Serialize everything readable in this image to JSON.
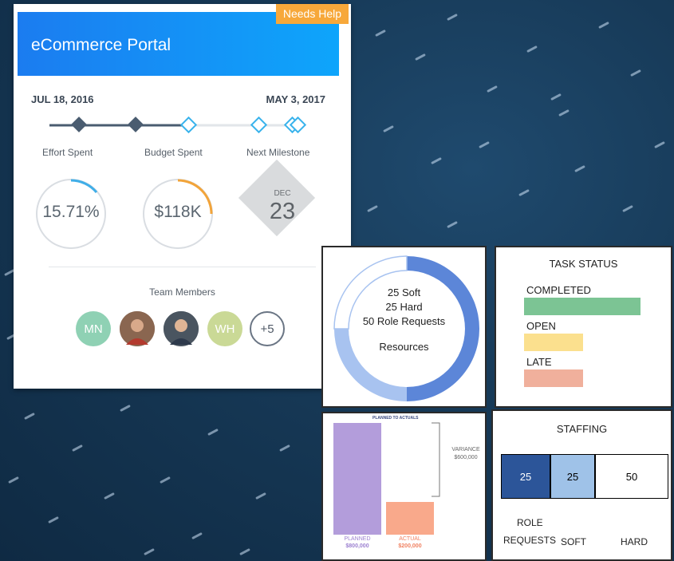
{
  "project_card": {
    "title": "eCommerce Portal",
    "status_badge": "Needs Help",
    "start_date": "JUL 18, 2016",
    "end_date": "MAY 3, 2017",
    "metrics": {
      "effort_label": "Effort Spent",
      "effort_value": "15.71%",
      "budget_label": "Budget Spent",
      "budget_value": "$118K",
      "milestone_label": "Next Milestone",
      "milestone_month": "DEC",
      "milestone_day": "23"
    },
    "team_label": "Team Members",
    "team": [
      {
        "initials": "MN",
        "color": "#8fd1b4"
      },
      {
        "initials": "",
        "icon": "user-photo-icon"
      },
      {
        "initials": "",
        "icon": "user-photo-icon"
      },
      {
        "initials": "WH",
        "color": "#cad996"
      },
      {
        "initials": "+5"
      }
    ]
  },
  "resources_panel": {
    "soft": "25 Soft",
    "hard": "25 Hard",
    "role_requests": "50 Role Requests",
    "label": "Resources"
  },
  "task_status_panel": {
    "title": "TASK STATUS",
    "items": [
      {
        "label": "COMPLETED",
        "fraction": 1.0,
        "color": "#7cc494"
      },
      {
        "label": "OPEN",
        "fraction": 0.5,
        "color": "#fbe08e"
      },
      {
        "label": "LATE",
        "fraction": 0.5,
        "color": "#f0b09c"
      }
    ]
  },
  "planned_panel": {
    "title": "PLANNED TO ACTUALS",
    "variance_label": "VARIANCE",
    "variance_value": "$600,000",
    "planned_label": "PLANNED",
    "planned_value": "$800,000",
    "actual_label": "ACTUAL",
    "actual_value": "$200,000",
    "planned_amount": 800000,
    "actual_amount": 200000,
    "planned_color": "#b39ddb",
    "actual_color": "#f9a98b"
  },
  "staffing_panel": {
    "title": "STAFFING",
    "cells": [
      {
        "value": "25",
        "color": "#2c5599"
      },
      {
        "value": "25",
        "color": "#9fc2e8"
      },
      {
        "value": "50",
        "color": "#ffffff"
      }
    ],
    "label_role_top": "ROLE",
    "label_role_bottom": "REQUESTS",
    "label_soft": "SOFT",
    "label_hard": "HARD"
  },
  "colors": {
    "accent": "#1b7cf0",
    "badge": "#f7a83a",
    "effort_arc": "#40aee8",
    "budget_arc": "#f2a43a",
    "timeline_dark": "#4a5c70",
    "timeline_light": "#39b3ec",
    "donut_dark": "#5c86d8",
    "donut_light": "#a8c3f0"
  }
}
